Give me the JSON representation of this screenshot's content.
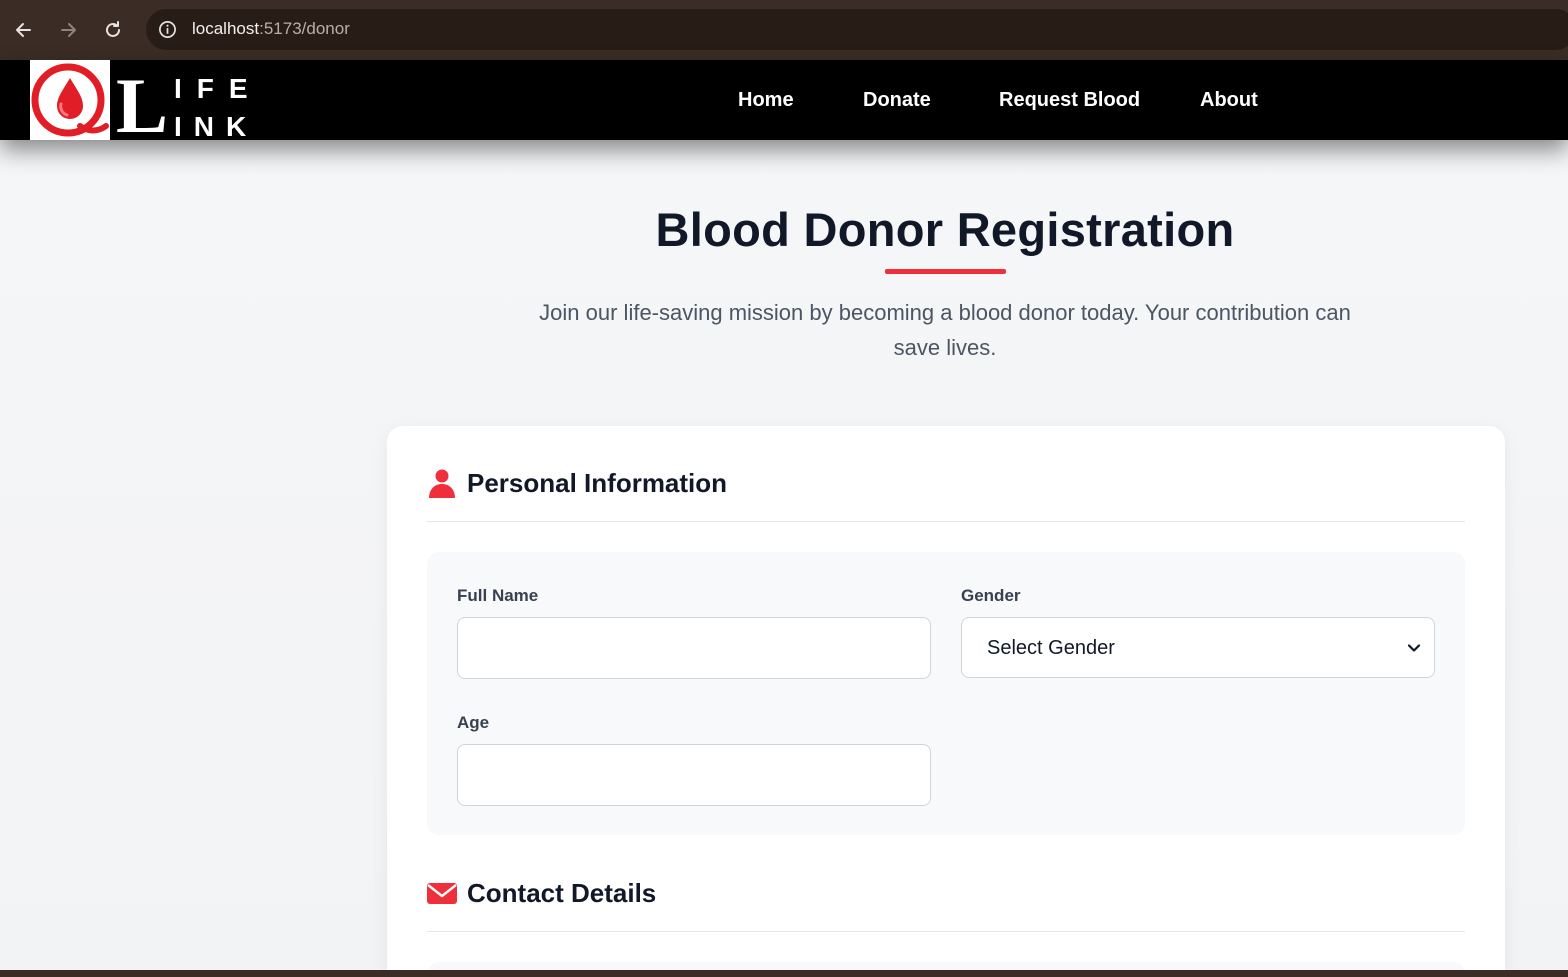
{
  "browser": {
    "url_host": "localhost",
    "url_path": ":5173/donor"
  },
  "nav": {
    "logo_letters_top": "IFE",
    "logo_letters_bottom": "INK",
    "logo_big_letter": "L",
    "links": [
      "Home",
      "Donate",
      "Request Blood",
      "About"
    ]
  },
  "hero": {
    "title": "Blood Donor Registration",
    "subtitle": "Join our life-saving mission by becoming a blood donor today. Your contribution can save lives."
  },
  "sections": {
    "personal": {
      "icon": "user-icon",
      "title": "Personal Information",
      "full_name_label": "Full Name",
      "full_name_value": "",
      "gender_label": "Gender",
      "gender_selected": "Select Gender",
      "age_label": "Age",
      "age_value": ""
    },
    "contact": {
      "icon": "envelope-icon",
      "title": "Contact Details"
    }
  },
  "colors": {
    "accent": "#ef2f3c",
    "nav_bg": "#000000",
    "title": "#111827"
  }
}
